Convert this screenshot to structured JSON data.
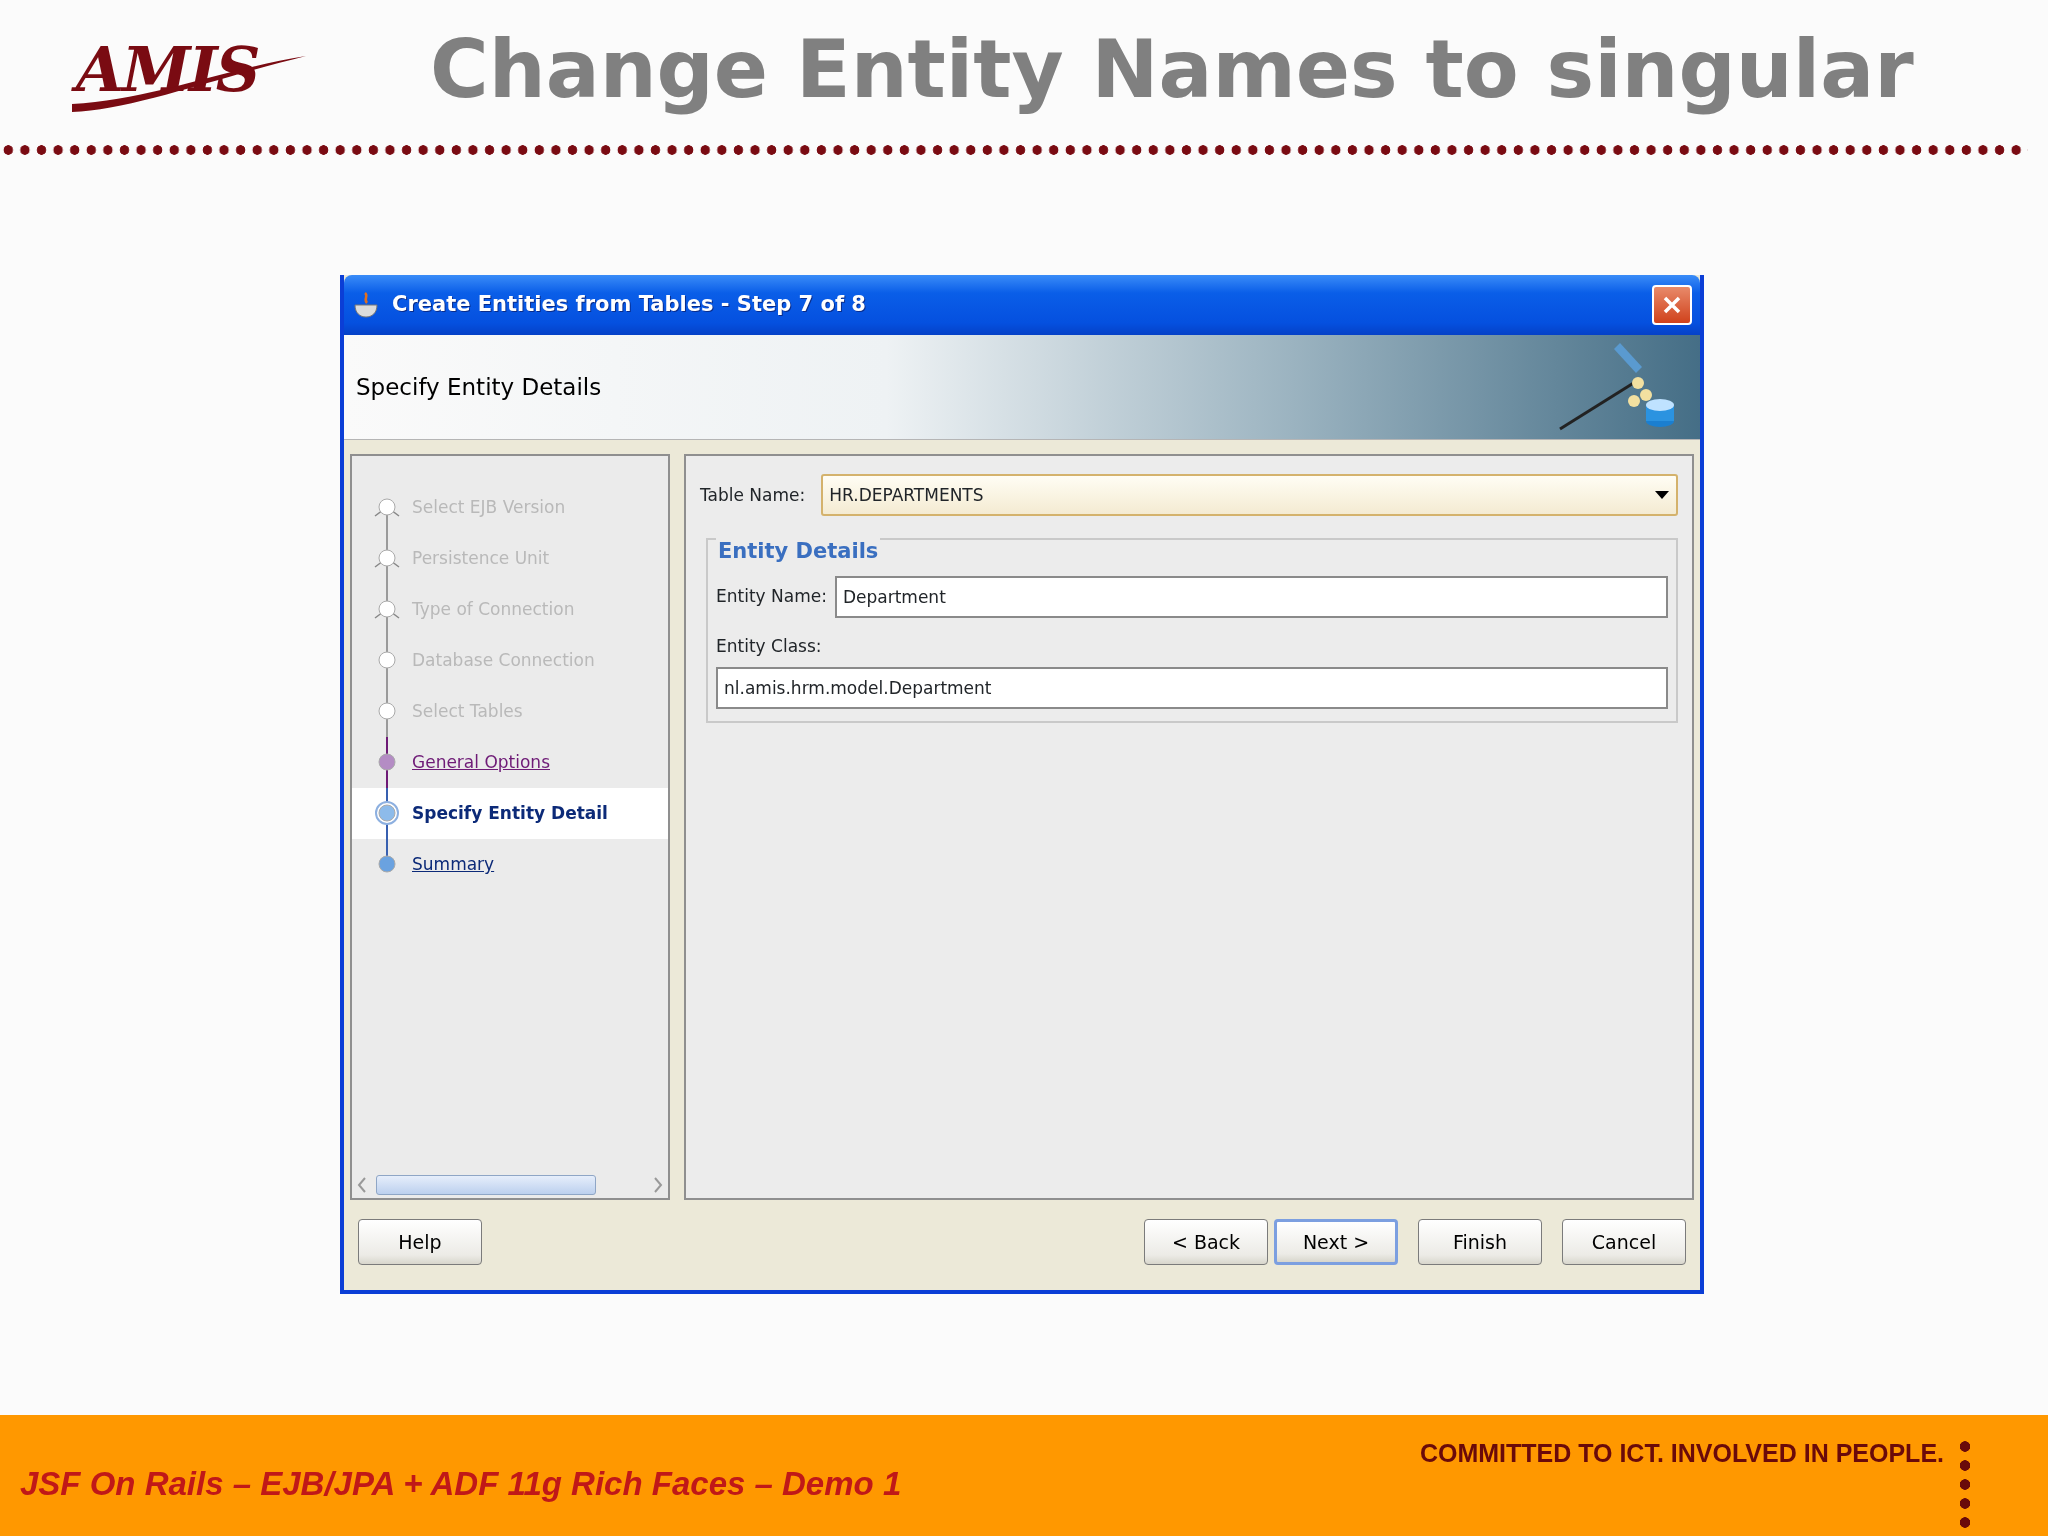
{
  "slide": {
    "logo": "AMIS",
    "title": "Change Entity Names to singular"
  },
  "dialog": {
    "title": "Create Entities from Tables - Step 7 of 8",
    "header": "Specify Entity Details",
    "steps": [
      {
        "label": "Select EJB Version",
        "kind": "done",
        "selected": false
      },
      {
        "label": "Persistence Unit",
        "kind": "done",
        "selected": false
      },
      {
        "label": "Type of Connection",
        "kind": "done",
        "selected": false
      },
      {
        "label": "Database Connection",
        "kind": "done",
        "selected": false
      },
      {
        "label": "Select Tables",
        "kind": "done",
        "selected": false
      },
      {
        "label": "General Options",
        "kind": "visited",
        "selected": false
      },
      {
        "label": "Specify Entity Detail",
        "kind": "current",
        "selected": true
      },
      {
        "label": "Summary",
        "kind": "next",
        "selected": false
      }
    ],
    "table_name": {
      "label": "Table Name:",
      "value": "HR.DEPARTMENTS"
    },
    "group": {
      "legend": "Entity Details",
      "fields": [
        {
          "label": "Entity Name:",
          "value": "Department",
          "kind": "inline"
        },
        {
          "label": "Entity Class:",
          "value": "nl.amis.hrm.model.Department",
          "kind": "stacked"
        }
      ]
    },
    "buttons": [
      {
        "label": "Help",
        "kind": "left",
        "default": false
      },
      {
        "label": "< Back",
        "kind": "right",
        "default": false
      },
      {
        "label": "Next >",
        "kind": "right",
        "default": true
      },
      {
        "label": "Finish",
        "kind": "right",
        "default": false
      },
      {
        "label": "Cancel",
        "kind": "right",
        "default": false
      }
    ]
  },
  "footer": {
    "subtitle": "JSF On Rails – EJB/JPA + ADF 11g Rich Faces – Demo 1",
    "tagline": "COMMITTED TO ICT. INVOLVED IN PEOPLE."
  }
}
